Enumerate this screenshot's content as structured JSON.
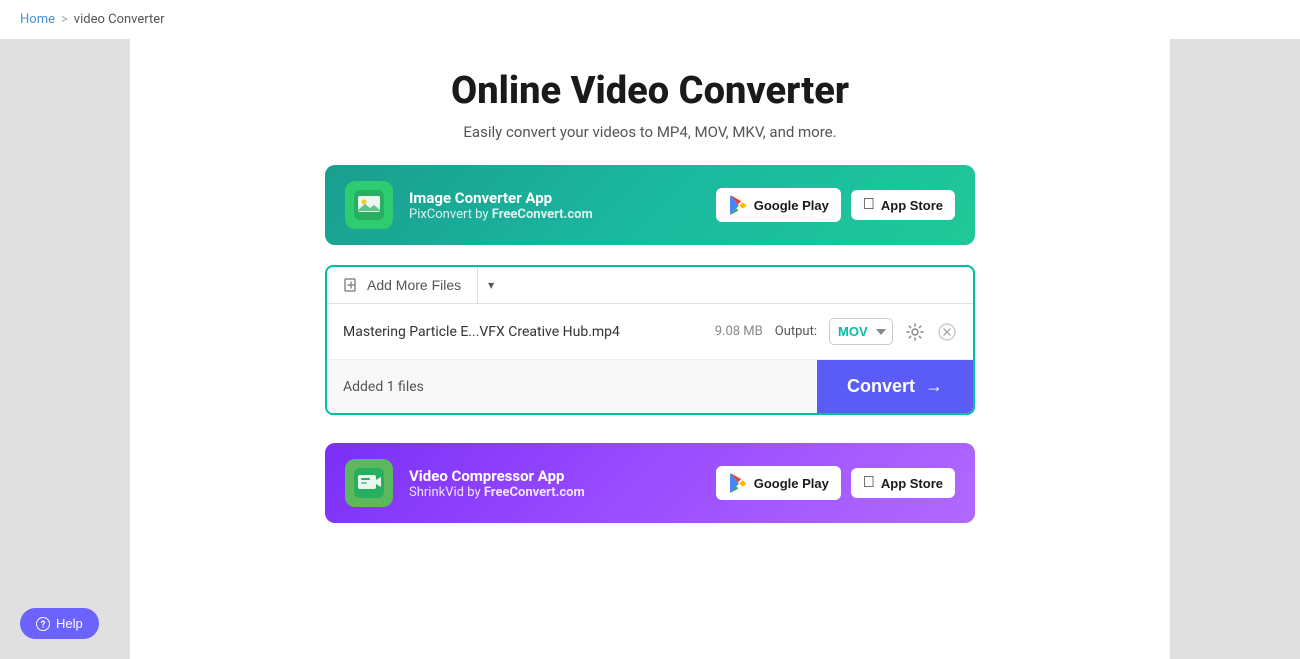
{
  "breadcrumb": {
    "home": "Home",
    "separator": ">",
    "current": "video Converter"
  },
  "page": {
    "title": "Online Video Converter",
    "subtitle": "Easily convert your videos to MP4, MOV, MKV, and more."
  },
  "image_banner": {
    "app_name": "Image Converter App",
    "app_sub_prefix": "PixConvert by ",
    "app_sub_brand": "FreeConvert.com",
    "google_play": "Google Play",
    "app_store": "App Store"
  },
  "video_banner": {
    "app_name": "Video Compressor App",
    "app_sub_prefix": "ShrinkVid by ",
    "app_sub_brand": "FreeConvert.com",
    "google_play": "Google Play",
    "app_store": "App Store"
  },
  "upload": {
    "add_files_label": "Add More Files",
    "file_name": "Mastering Particle E...VFX Creative Hub.mp4",
    "file_size": "9.08 MB",
    "output_label": "Output:",
    "output_format": "MOV",
    "added_files_text": "Added 1 files",
    "convert_label": "Convert",
    "convert_arrow": "→"
  },
  "help": {
    "label": "Help"
  }
}
